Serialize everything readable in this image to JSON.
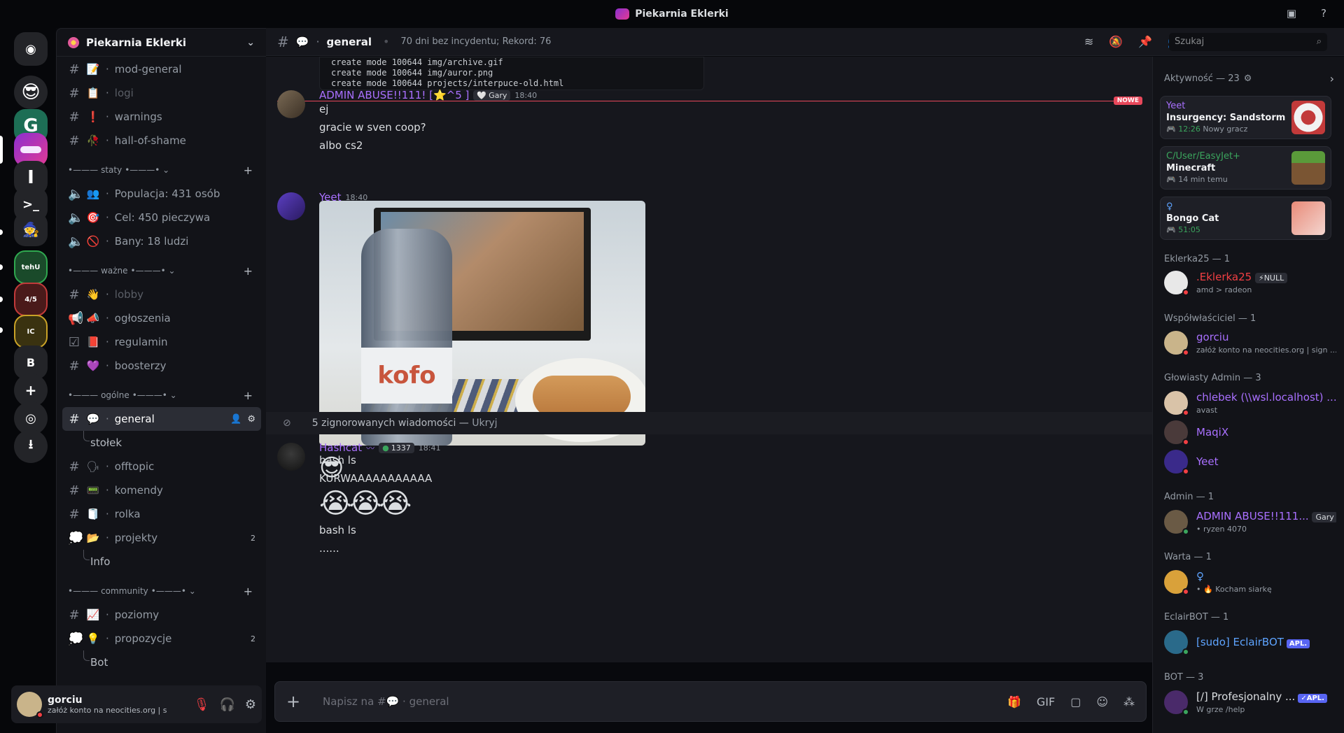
{
  "titlebar": {
    "title": "Piekarnia Eklerki"
  },
  "server": {
    "name": "Piekarnia Eklerki"
  },
  "channels": {
    "top": [
      {
        "emoji": "📝",
        "name": "mod-general",
        "muted": false
      },
      {
        "emoji": "📋",
        "name": "logi",
        "muted": true
      },
      {
        "emoji": "❗",
        "name": "warnings",
        "muted": false
      },
      {
        "emoji": "🥀",
        "name": "hall-of-shame",
        "muted": false
      }
    ],
    "cat_staty": "staty",
    "staty": [
      {
        "emoji": "👥",
        "name": "Populacja: 431 osób"
      },
      {
        "emoji": "🎯",
        "name": "Cel: 450 pieczywa"
      },
      {
        "emoji": "🚫",
        "name": "Bany: 18 ludzi"
      }
    ],
    "cat_wazne": "ważne",
    "wazne": [
      {
        "emoji": "👋",
        "name": "lobby"
      },
      {
        "emoji": "📣",
        "name": "ogłoszenia"
      },
      {
        "emoji": "📕",
        "name": "regulamin"
      },
      {
        "emoji": "💜",
        "name": "boosterzy"
      }
    ],
    "cat_ogolne": "ogólne",
    "ogolne": [
      {
        "emoji": "💬",
        "name": "general"
      },
      {
        "thread": "stołek"
      },
      {
        "emoji": "🗣",
        "name": "offtopic"
      },
      {
        "emoji": "📟",
        "name": "komendy"
      },
      {
        "emoji": "🧻",
        "name": "rolka"
      },
      {
        "emoji": "📂",
        "name": "projekty",
        "badge": "2"
      },
      {
        "thread": "Info"
      }
    ],
    "cat_community": "community",
    "community": [
      {
        "emoji": "📈",
        "name": "poziomy"
      },
      {
        "emoji": "💡",
        "name": "propozycje",
        "badge": "2"
      },
      {
        "thread": "Bot"
      }
    ]
  },
  "user": {
    "name": "gorciu",
    "status": "załóż konto na neocities.org | si..."
  },
  "chat": {
    "channel": "general",
    "topic": "70 dni bez incydentu; Rekord: 76",
    "search_placeholder": "Szukaj",
    "code_lines": [
      "create mode 100644 img/archive.gif",
      "create mode 100644 img/auror.png",
      "create mode 100644 projects/interpuce-old.html"
    ],
    "new_label": "NOWE",
    "msg1": {
      "author": "ADMIN ABUSE!!111! [⭐^5 ]",
      "tag": "Gary",
      "time": "18:40",
      "lines": [
        "ej",
        "gracie w sven coop?",
        "albo cs2"
      ]
    },
    "msg2": {
      "author": "Yeet",
      "time": "18:40",
      "bottle_text": "kofo"
    },
    "ignored": {
      "text": "5 zignorowanych wiadomości — ",
      "link": "Ukryj"
    },
    "msg3": {
      "author": "Hashcat",
      "tag": "1337",
      "time": "18:41",
      "lines": [
        "bash ls",
        "KURWAAAAAAAAAAA",
        "bash ls",
        "......"
      ]
    },
    "composer_placeholder": "Napisz na #💬 · general"
  },
  "members": {
    "activity_header": "Aktywność — 23",
    "activities": [
      {
        "who": "Yeet",
        "game": "Insurgency: Sandstorm",
        "meta": "12:26",
        "extra": "Nowy gracz",
        "color": "#a970ff"
      },
      {
        "who": "C/User/EasyJet+",
        "game": "Minecraft",
        "meta": "14 min temu",
        "extra": "",
        "color": "#3ba55d"
      },
      {
        "who": "♀",
        "game": "Bongo Cat",
        "meta": "51:05",
        "extra": "",
        "color": "#5ea4ff"
      }
    ],
    "groups": [
      {
        "title": "Eklerka25 — 1"
      },
      {
        "title": "Współwłaściciel — 1"
      },
      {
        "title": "Głowiasty Admin — 3"
      },
      {
        "title": "Admin — 1"
      },
      {
        "title": "Warta — 1"
      },
      {
        "title": "EclairBOT — 1"
      },
      {
        "title": "BOT — 3"
      }
    ],
    "list": [
      {
        "name": ".Eklerka25",
        "sub": "amd > radeon",
        "color": "#f23f43",
        "tag": "⚡NULL"
      },
      {
        "name": "gorciu",
        "sub": "załóż konto na neocities.org | sign ...",
        "color": "#a970ff"
      },
      {
        "name": "chlebek (\\\\wsl.localhost) ...",
        "sub": "avast",
        "color": "#a970ff"
      },
      {
        "name": "MaqiX",
        "sub": "",
        "color": "#a970ff"
      },
      {
        "name": "Yeet",
        "sub": "",
        "color": "#a970ff"
      },
      {
        "name": "ADMIN ABUSE!!111...",
        "sub": "• ryzen 4070",
        "color": "#a970ff",
        "tag": "Gary"
      },
      {
        "name": "♀",
        "sub": "• 🔥 Kocham siarkę",
        "color": "#5ea4ff"
      },
      {
        "name": "[sudo] EclairBOT",
        "sub": "",
        "color": "#5ea4ff",
        "tag": "APL."
      },
      {
        "name": "[/] Profesjonalny ...",
        "sub": "W grze /help",
        "color": "#dbdee1",
        "tag": "✓APL."
      }
    ]
  }
}
